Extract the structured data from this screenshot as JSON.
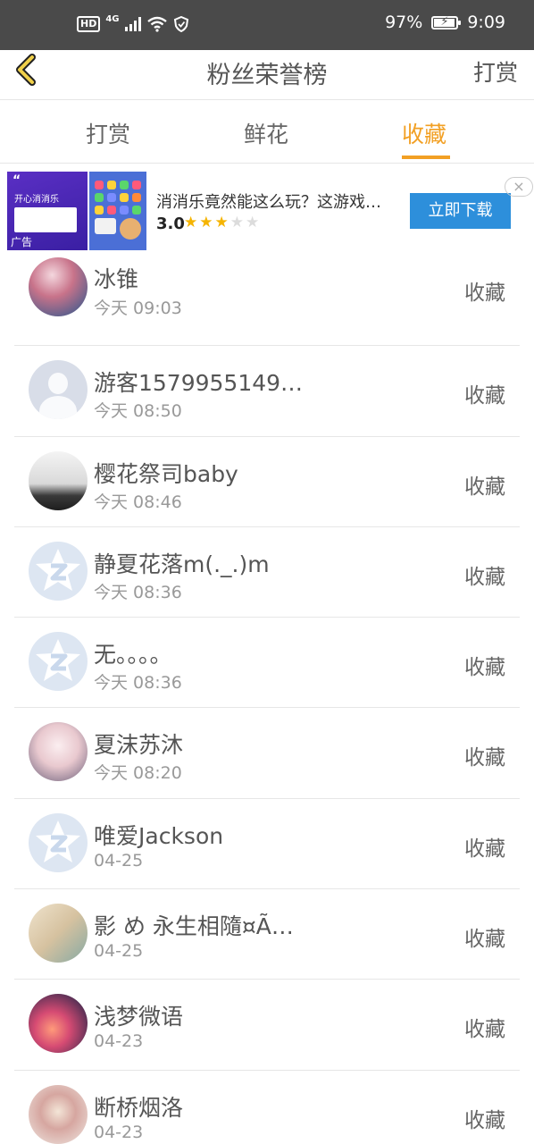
{
  "status_bar": {
    "hd": "HD",
    "network": "4G",
    "battery": "97%",
    "battery_level": 0.97,
    "time": "9:09"
  },
  "header": {
    "title": "粉丝荣誉榜",
    "right_label": "打赏",
    "back_icon": "chevron-left-icon"
  },
  "tabs": [
    {
      "label": "打赏",
      "active": false
    },
    {
      "label": "鲜花",
      "active": false
    },
    {
      "label": "收藏",
      "active": true
    }
  ],
  "ad": {
    "image_title": "开心消消乐",
    "image_label": "广告",
    "title": "消消乐竟然能这么玩？这游戏…",
    "rating": "3.0",
    "stars": 3,
    "max_stars": 5,
    "cta": "立即下载",
    "close": "×"
  },
  "list": [
    {
      "name": "冰锥",
      "time": "今天 09:03",
      "action": "收藏",
      "avatar": "photo"
    },
    {
      "name": "游客1579955149…",
      "time": "今天 08:50",
      "action": "收藏",
      "avatar": "default-user"
    },
    {
      "name": "樱花祭司baby",
      "time": "今天 08:46",
      "action": "收藏",
      "avatar": "photo"
    },
    {
      "name": "静夏花落m(._.)m",
      "time": "今天 08:36",
      "action": "收藏",
      "avatar": "qq-default"
    },
    {
      "name": "无。。。。",
      "time": "今天 08:36",
      "action": "收藏",
      "avatar": "qq-default"
    },
    {
      "name": "夏沫苏沐",
      "time": "今天 08:20",
      "action": "收藏",
      "avatar": "photo"
    },
    {
      "name": "唯爱Jackson",
      "time": "04-25",
      "action": "收藏",
      "avatar": "qq-default"
    },
    {
      "name": "影 め 永生相隨¤Ã…",
      "time": "04-25",
      "action": "收藏",
      "avatar": "photo"
    },
    {
      "name": "浅梦微语",
      "time": "04-23",
      "action": "收藏",
      "avatar": "photo"
    },
    {
      "name": "断桥烟洛",
      "time": "04-23",
      "action": "收藏",
      "avatar": "photo"
    }
  ],
  "colors": {
    "accent": "#f2a024",
    "status_bar": "#4a4a4a",
    "cta": "#2d8fdb"
  }
}
